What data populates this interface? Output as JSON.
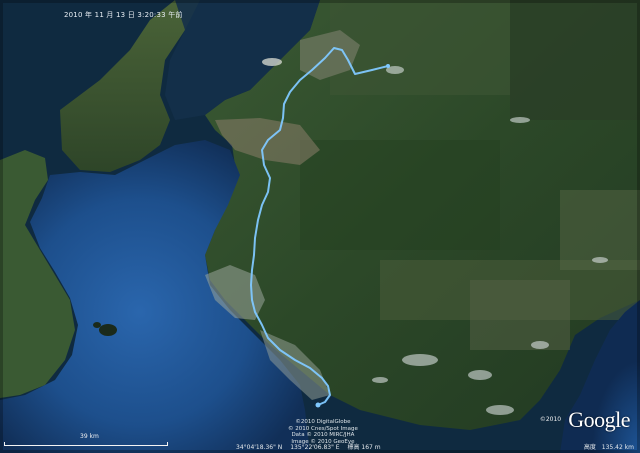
{
  "map": {
    "timestamp": "2010 年 11 月 13 日    3:20:33 午前",
    "scale_label": "39 km",
    "imagery_credits": [
      "©2010 DigitalGlobe",
      "© 2010 Cnes/Spot Image",
      "Data © 2010 MIRC/JHA",
      "Image © 2010 GeoEye"
    ],
    "status": {
      "latitude": "34°04'18.36\" N",
      "longitude": "135°22'06.83\" E",
      "elevation": "標高  167 m"
    },
    "eye_altitude": {
      "label": "高度",
      "value": "135.42 km"
    },
    "brand": {
      "copyright": "©2010",
      "logo": "Google"
    },
    "colors": {
      "ocean": "#1c4f8c",
      "land": "#2f4a2a",
      "route": "#7fc8ff"
    }
  }
}
